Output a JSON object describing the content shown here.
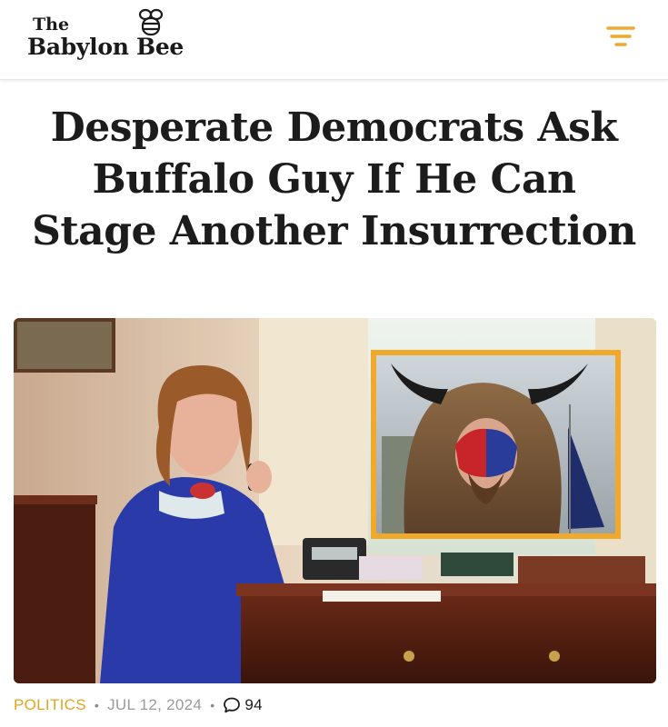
{
  "site": {
    "logo_the": "The",
    "logo_name": "Babylon Bee",
    "brand_color": "#f0a92b",
    "menu_icon": "filter-menu-icon"
  },
  "article": {
    "headline": "Desperate Democrats Ask Buffalo Guy If He Can Stage Another Insurrection",
    "image_icon": "article-photo"
  },
  "meta": {
    "category": "POLITICS",
    "date": "JUL 12, 2024",
    "comment_icon": "comment-bubble-icon",
    "comment_count": "94"
  }
}
